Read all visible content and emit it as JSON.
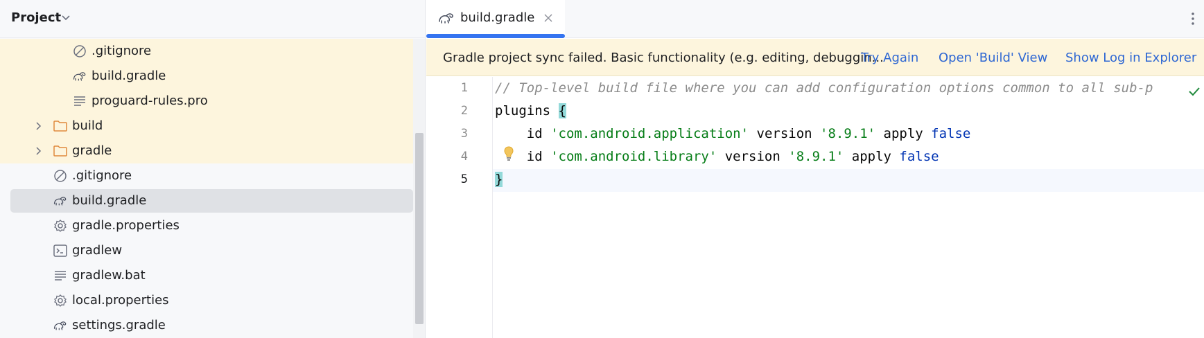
{
  "project": {
    "title": "Project",
    "tree": [
      {
        "label": ".gitignore",
        "icon": "gitignore-icon",
        "highlighted": true,
        "selected": false,
        "expandable": false
      },
      {
        "label": "build.gradle",
        "icon": "gradle-icon",
        "highlighted": true,
        "selected": false,
        "expandable": false
      },
      {
        "label": "proguard-rules.pro",
        "icon": "text-file-icon",
        "highlighted": true,
        "selected": false,
        "expandable": false
      },
      {
        "label": "build",
        "icon": "folder-icon",
        "highlighted": true,
        "selected": false,
        "expandable": true
      },
      {
        "label": "gradle",
        "icon": "folder-icon",
        "highlighted": true,
        "selected": false,
        "expandable": true
      },
      {
        "label": ".gitignore",
        "icon": "gitignore-icon",
        "highlighted": false,
        "selected": false,
        "expandable": false
      },
      {
        "label": "build.gradle",
        "icon": "gradle-icon",
        "highlighted": false,
        "selected": true,
        "expandable": false
      },
      {
        "label": "gradle.properties",
        "icon": "settings-file-icon",
        "highlighted": false,
        "selected": false,
        "expandable": false
      },
      {
        "label": "gradlew",
        "icon": "terminal-file-icon",
        "highlighted": false,
        "selected": false,
        "expandable": false
      },
      {
        "label": "gradlew.bat",
        "icon": "text-file-icon",
        "highlighted": false,
        "selected": false,
        "expandable": false
      },
      {
        "label": "local.properties",
        "icon": "settings-file-icon",
        "highlighted": false,
        "selected": false,
        "expandable": false
      },
      {
        "label": "settings.gradle",
        "icon": "gradle-icon",
        "highlighted": false,
        "selected": false,
        "expandable": false
      }
    ]
  },
  "editor": {
    "tab": {
      "label": "build.gradle",
      "icon": "gradle-icon",
      "active": true
    },
    "banner": {
      "message": "Gradle project sync failed. Basic functionality (e.g. editing, debuggin...",
      "actions": [
        "Try Again",
        "Open 'Build' View",
        "Show Log in Explorer"
      ]
    },
    "current_line": 5,
    "lines": [
      {
        "num": "1",
        "tokens": [
          {
            "text": "// Top-level build file where you can add configuration options common to all sub-p",
            "type": "comment"
          }
        ]
      },
      {
        "num": "2",
        "tokens": [
          {
            "text": "plugins ",
            "type": "plain"
          },
          {
            "text": "{",
            "type": "brace"
          }
        ]
      },
      {
        "num": "3",
        "tokens": [
          {
            "text": "    id ",
            "type": "plain"
          },
          {
            "text": "'com.android.application'",
            "type": "str"
          },
          {
            "text": " version ",
            "type": "plain"
          },
          {
            "text": "'8.9.1'",
            "type": "str"
          },
          {
            "text": " apply ",
            "type": "plain"
          },
          {
            "text": "false",
            "type": "kw"
          }
        ]
      },
      {
        "num": "4",
        "tokens": [
          {
            "text": "    id ",
            "type": "plain"
          },
          {
            "text": "'com.android.library'",
            "type": "str"
          },
          {
            "text": " version ",
            "type": "plain"
          },
          {
            "text": "'8.9.1'",
            "type": "str"
          },
          {
            "text": " apply ",
            "type": "plain"
          },
          {
            "text": "false",
            "type": "kw"
          }
        ]
      },
      {
        "num": "5",
        "tokens": [
          {
            "text": "}",
            "type": "brace"
          }
        ]
      }
    ]
  },
  "colors": {
    "accent": "#3574f0",
    "banner_bg": "#fdf5dd",
    "link": "#2e67d3",
    "string": "#067d17",
    "keyword": "#0033b3",
    "comment": "#8c8c8c",
    "brace_highlight": "#93d9d9"
  }
}
